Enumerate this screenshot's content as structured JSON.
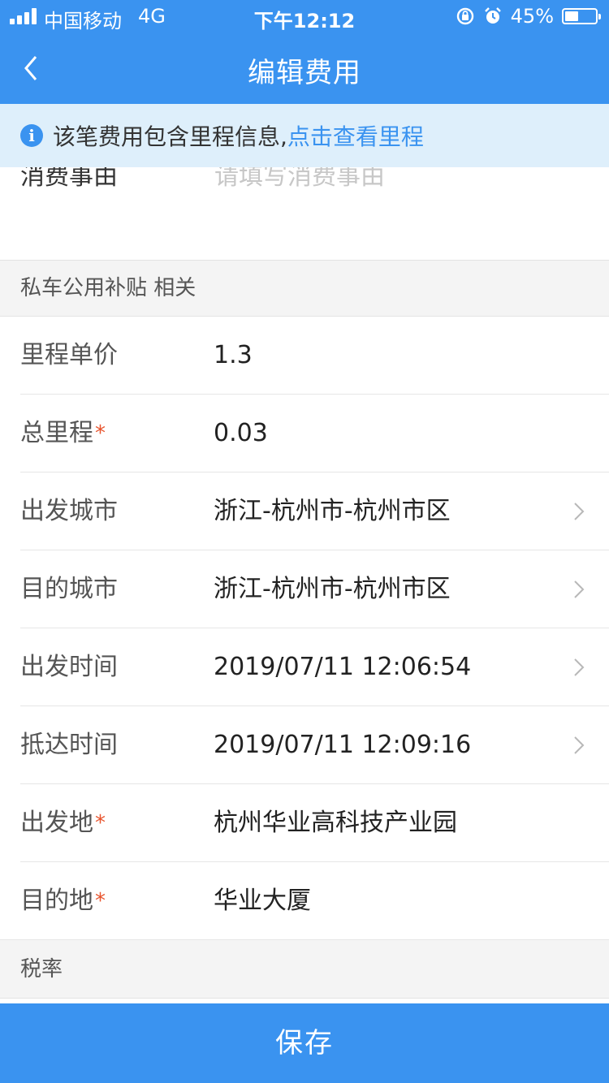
{
  "status_bar": {
    "carrier": "中国移动",
    "network": "4G",
    "time": "下午12:12",
    "battery": "45%",
    "battery_level": 0.45,
    "icons": [
      "signal-icon",
      "rotation-lock-icon",
      "alarm-icon",
      "battery-icon"
    ]
  },
  "nav": {
    "title": "编辑费用",
    "back_icon": "chevron-left-icon"
  },
  "notice": {
    "icon": "info-icon",
    "icon_glyph": "i",
    "text": "该笔费用包含里程信息,",
    "link": "点击查看里程"
  },
  "cut_row": {
    "label": "消费事由",
    "placeholder": "请填写消费事由"
  },
  "sections": {
    "vehicle": "私车公用补贴 相关",
    "tax": "税率"
  },
  "rows": [
    {
      "label": "里程单价",
      "value": "1.3",
      "required": false,
      "chevron": false
    },
    {
      "label": "总里程",
      "value": "0.03",
      "required": true,
      "chevron": false
    },
    {
      "label": "出发城市",
      "value": "浙江-杭州市-杭州市区",
      "required": false,
      "chevron": true
    },
    {
      "label": "目的城市",
      "value": "浙江-杭州市-杭州市区",
      "required": false,
      "chevron": true
    },
    {
      "label": "出发时间",
      "value": "2019/07/11 12:06:54",
      "required": false,
      "chevron": true
    },
    {
      "label": "抵达时间",
      "value": "2019/07/11 12:09:16",
      "required": false,
      "chevron": true
    },
    {
      "label": "出发地",
      "value": "杭州华业高科技产业园",
      "required": true,
      "chevron": false
    },
    {
      "label": "目的地",
      "value": "华业大厦",
      "required": true,
      "chevron": false
    }
  ],
  "required_mark": "*",
  "save_label": "保存",
  "colors": {
    "primary": "#3a93f0",
    "notice_bg": "#deeffb",
    "required": "#e8542e"
  }
}
